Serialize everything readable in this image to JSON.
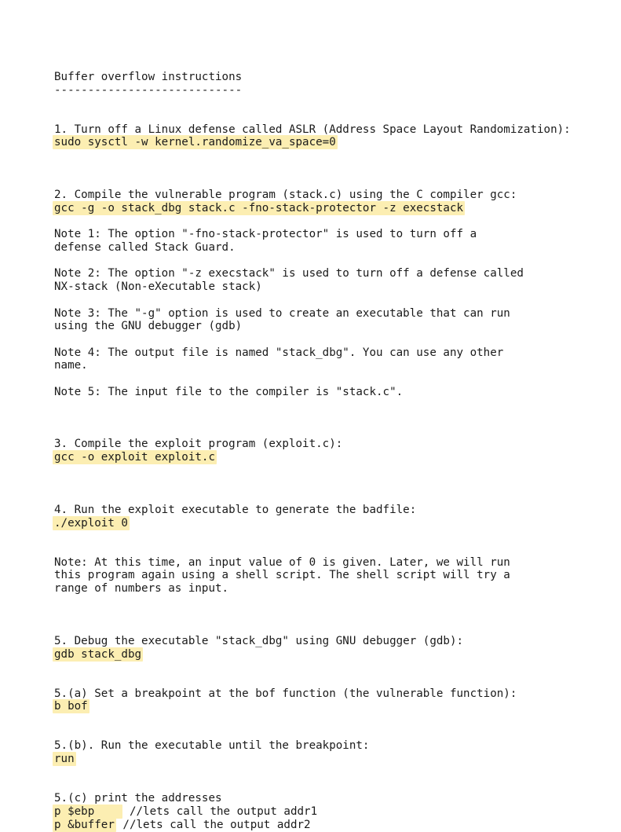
{
  "document": {
    "title": "Buffer overflow instructions",
    "title_rule": "----------------------------",
    "highlight_color": "#fceeb2",
    "text_color": "#1a1a1a",
    "background_color": "#ffffff",
    "lines": [
      {
        "type": "heading",
        "text": "Buffer overflow instructions"
      },
      {
        "type": "rule",
        "text": "----------------------------"
      },
      {
        "type": "blank",
        "text": ""
      },
      {
        "type": "blank",
        "text": ""
      },
      {
        "type": "text",
        "text": "1. Turn off a Linux defense called ASLR (Address Space Layout Randomization):"
      },
      {
        "type": "command",
        "text": "sudo sysctl -w kernel.randomize_va_space=0"
      },
      {
        "type": "blank",
        "text": ""
      },
      {
        "type": "blank",
        "text": ""
      },
      {
        "type": "blank",
        "text": ""
      },
      {
        "type": "text",
        "text": "2. Compile the vulnerable program (stack.c) using the C compiler gcc:"
      },
      {
        "type": "command",
        "text": "gcc -g -o stack_dbg stack.c -fno-stack-protector -z execstack"
      },
      {
        "type": "blank",
        "text": ""
      },
      {
        "type": "text",
        "text": "Note 1: The option \"-fno-stack-protector\" is used to turn off a"
      },
      {
        "type": "text",
        "text": "defense called Stack Guard."
      },
      {
        "type": "blank",
        "text": ""
      },
      {
        "type": "text",
        "text": "Note 2: The option \"-z execstack\" is used to turn off a defense called"
      },
      {
        "type": "text",
        "text": "NX-stack (Non-eXecutable stack)"
      },
      {
        "type": "blank",
        "text": ""
      },
      {
        "type": "text",
        "text": "Note 3: The \"-g\" option is used to create an executable that can run"
      },
      {
        "type": "text",
        "text": "using the GNU debugger (gdb)"
      },
      {
        "type": "blank",
        "text": ""
      },
      {
        "type": "text",
        "text": "Note 4: The output file is named \"stack_dbg\". You can use any other"
      },
      {
        "type": "text",
        "text": "name."
      },
      {
        "type": "blank",
        "text": ""
      },
      {
        "type": "text",
        "text": "Note 5: The input file to the compiler is \"stack.c\"."
      },
      {
        "type": "blank",
        "text": ""
      },
      {
        "type": "blank",
        "text": ""
      },
      {
        "type": "blank",
        "text": ""
      },
      {
        "type": "text",
        "text": "3. Compile the exploit program (exploit.c):"
      },
      {
        "type": "command",
        "text": "gcc -o exploit exploit.c"
      },
      {
        "type": "blank",
        "text": ""
      },
      {
        "type": "blank",
        "text": ""
      },
      {
        "type": "blank",
        "text": ""
      },
      {
        "type": "text",
        "text": "4. Run the exploit executable to generate the badfile:"
      },
      {
        "type": "command",
        "text": "./exploit 0"
      },
      {
        "type": "blank",
        "text": ""
      },
      {
        "type": "blank",
        "text": ""
      },
      {
        "type": "text",
        "text": "Note: At this time, an input value of 0 is given. Later, we will run"
      },
      {
        "type": "text",
        "text": "this program again using a shell script. The shell script will try a"
      },
      {
        "type": "text",
        "text": "range of numbers as input."
      },
      {
        "type": "blank",
        "text": ""
      },
      {
        "type": "blank",
        "text": ""
      },
      {
        "type": "blank",
        "text": ""
      },
      {
        "type": "text",
        "text": "5. Debug the executable \"stack_dbg\" using GNU debugger (gdb):"
      },
      {
        "type": "command",
        "text": "gdb stack_dbg"
      },
      {
        "type": "blank",
        "text": ""
      },
      {
        "type": "blank",
        "text": ""
      },
      {
        "type": "text",
        "text": "5.(a) Set a breakpoint at the bof function (the vulnerable function):"
      },
      {
        "type": "command",
        "text": "b bof"
      },
      {
        "type": "blank",
        "text": ""
      },
      {
        "type": "blank",
        "text": ""
      },
      {
        "type": "text",
        "text": "5.(b). Run the executable until the breakpoint:"
      },
      {
        "type": "command",
        "text": "run"
      },
      {
        "type": "blank",
        "text": ""
      },
      {
        "type": "blank",
        "text": ""
      },
      {
        "type": "text",
        "text": "5.(c) print the addresses"
      },
      {
        "type": "command",
        "highlight": "p $ebp    ",
        "text": "p $ebp    ",
        "trailing": " //lets call the output addr1"
      },
      {
        "type": "command",
        "highlight": "p &buffer",
        "text": "p &buffer",
        "trailing": " //lets call the output addr2"
      }
    ]
  }
}
